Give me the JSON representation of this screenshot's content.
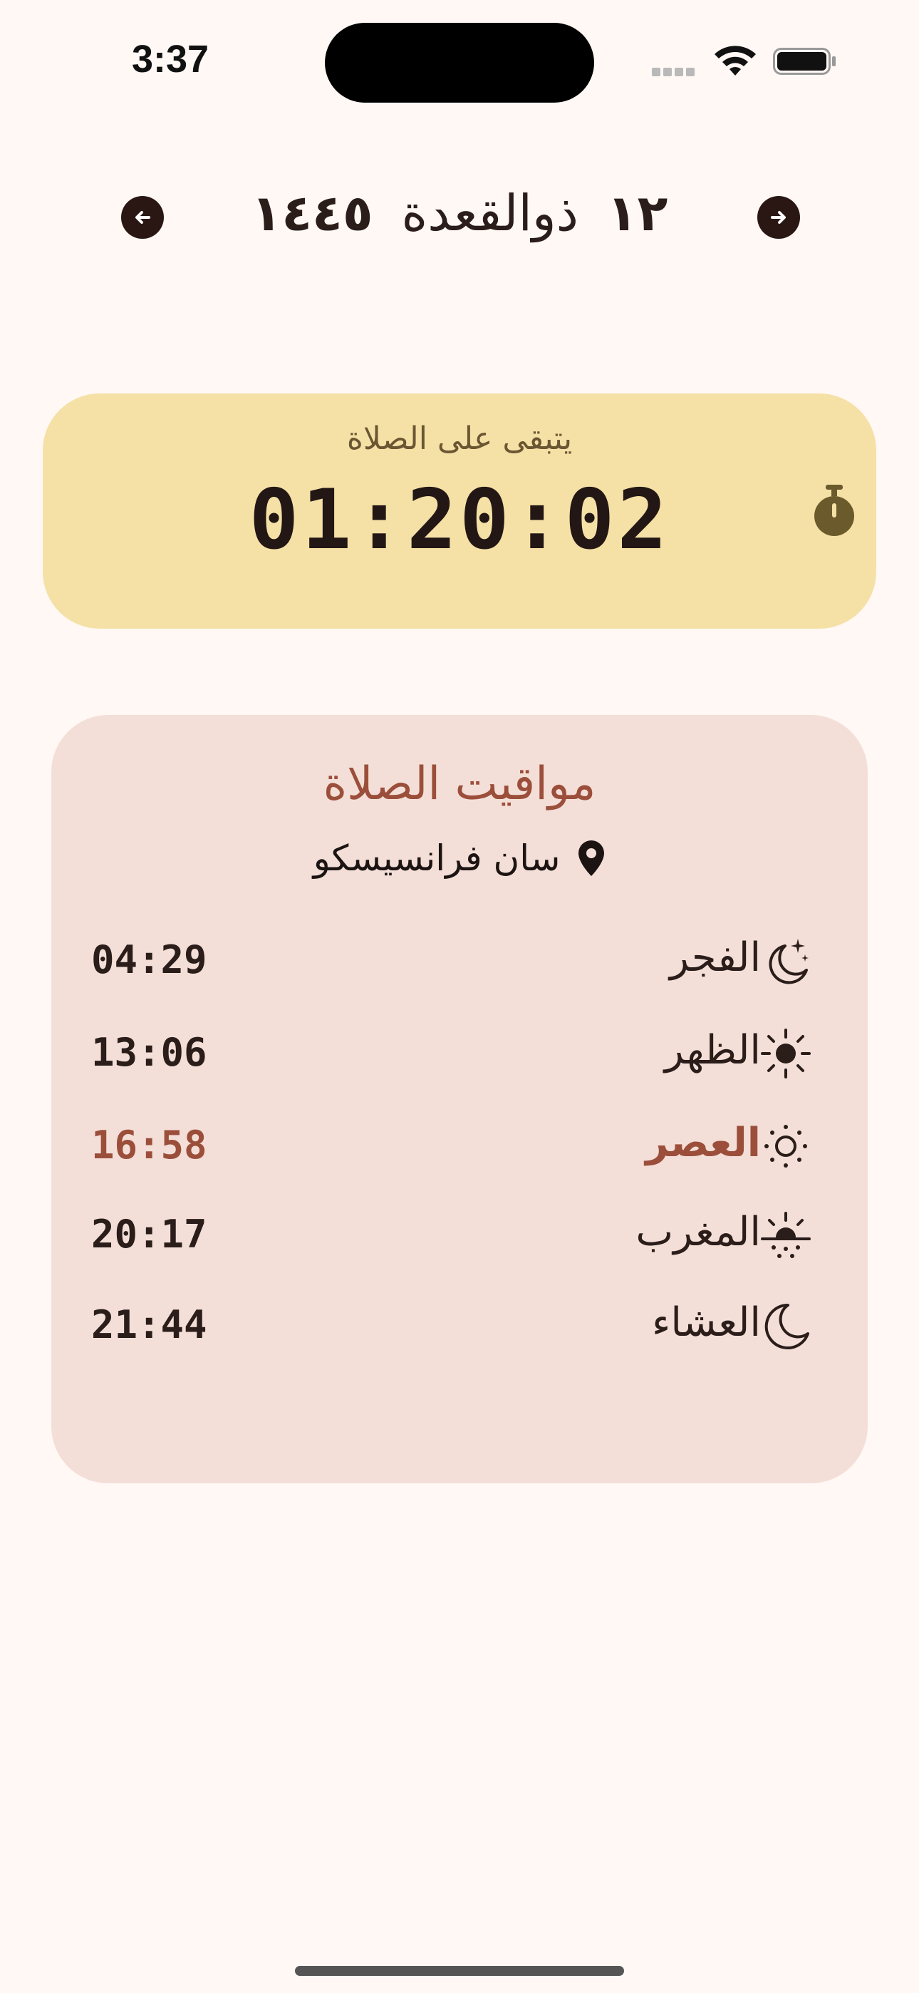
{
  "status_bar": {
    "time": "3:37"
  },
  "header": {
    "day": "١٢",
    "month": "ذوالقعدة",
    "year": "١٤٤٥",
    "prev_icon": "arrow-left-icon",
    "next_icon": "arrow-right-icon"
  },
  "countdown": {
    "label": "يتبقى على الصلاة",
    "value": "01:20:02",
    "icon": "stopwatch-icon"
  },
  "prayer_card": {
    "title": "مواقيت الصلاة",
    "location": "سان فرانسيسكو",
    "location_icon": "location-pin-icon",
    "prayers": [
      {
        "name": "الفجر",
        "time": "04:29",
        "icon": "moon-stars-icon",
        "active": false
      },
      {
        "name": "الظهر",
        "time": "13:06",
        "icon": "sun-icon",
        "active": false
      },
      {
        "name": "العصر",
        "time": "16:58",
        "icon": "sun-outline-icon",
        "active": true
      },
      {
        "name": "المغرب",
        "time": "20:17",
        "icon": "sunset-icon",
        "active": false
      },
      {
        "name": "العشاء",
        "time": "21:44",
        "icon": "crescent-moon-icon",
        "active": false
      }
    ]
  },
  "colors": {
    "background": "#fff8f5",
    "countdown_card": "#f5e1a6",
    "prayer_card": "#f4dfd8",
    "accent": "#9b4f3b",
    "dark": "#2a1713"
  }
}
